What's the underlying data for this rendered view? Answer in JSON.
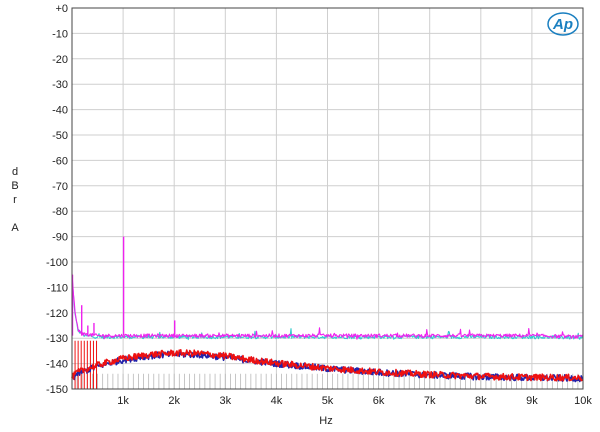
{
  "chart_data": {
    "type": "line",
    "title": "",
    "xlabel": "Hz",
    "ylabel_letters": [
      "d",
      "B",
      "r",
      "",
      "A"
    ],
    "xlim": [
      0,
      10000
    ],
    "ylim": [
      -150,
      0
    ],
    "grid": true,
    "x_ticks": [
      {
        "value": 1000,
        "label": "1k"
      },
      {
        "value": 2000,
        "label": "2k"
      },
      {
        "value": 3000,
        "label": "3k"
      },
      {
        "value": 4000,
        "label": "4k"
      },
      {
        "value": 5000,
        "label": "5k"
      },
      {
        "value": 6000,
        "label": "6k"
      },
      {
        "value": 7000,
        "label": "7k"
      },
      {
        "value": 8000,
        "label": "8k"
      },
      {
        "value": 9000,
        "label": "9k"
      },
      {
        "value": 10000,
        "label": "10k"
      }
    ],
    "y_ticks": [
      {
        "value": 0,
        "label": "+0"
      },
      {
        "value": -10,
        "label": "-10"
      },
      {
        "value": -20,
        "label": "-20"
      },
      {
        "value": -30,
        "label": "-30"
      },
      {
        "value": -40,
        "label": "-40"
      },
      {
        "value": -50,
        "label": "-50"
      },
      {
        "value": -60,
        "label": "-60"
      },
      {
        "value": -70,
        "label": "-70"
      },
      {
        "value": -80,
        "label": "-80"
      },
      {
        "value": -90,
        "label": "-90"
      },
      {
        "value": -100,
        "label": "-100"
      },
      {
        "value": -110,
        "label": "-110"
      },
      {
        "value": -120,
        "label": "-120"
      },
      {
        "value": -130,
        "label": "-130"
      },
      {
        "value": -140,
        "label": "-140"
      },
      {
        "value": -150,
        "label": "-150"
      }
    ],
    "series": [
      {
        "color": "#33cccc",
        "x": [
          0,
          60,
          120,
          250,
          500,
          1000,
          1500,
          2000,
          3000,
          4000,
          5000,
          6000,
          7000,
          8000,
          9000,
          10000
        ],
        "y": [
          -106,
          -121,
          -127,
          -129,
          -129.5,
          -129.5,
          -129.5,
          -129.5,
          -129.5,
          -129.5,
          -129.5,
          -129.5,
          -129.5,
          -129.5,
          -129.5,
          -129.8
        ]
      },
      {
        "color": "#ee22ee",
        "x": [
          0,
          60,
          120,
          250,
          500,
          1000,
          1500,
          2000,
          3000,
          4000,
          5000,
          6000,
          7000,
          8000,
          9000,
          10000
        ],
        "y": [
          -105,
          -120,
          -127,
          -128.5,
          -129,
          -129,
          -129,
          -129,
          -129,
          -129,
          -129,
          -129,
          -129,
          -129,
          -129,
          -129.5
        ]
      },
      {
        "color": "#2222aa",
        "x": [
          0,
          100,
          300,
          600,
          1000,
          1500,
          2000,
          2500,
          3000,
          3500,
          4000,
          5000,
          6000,
          7000,
          8000,
          9000,
          10000
        ],
        "y": [
          -146,
          -144,
          -142.5,
          -140.5,
          -138.5,
          -137,
          -136.3,
          -136.5,
          -137.5,
          -138.8,
          -140,
          -142,
          -143.5,
          -144.5,
          -145.2,
          -145.6,
          -145.8
        ]
      },
      {
        "color": "#ee1111",
        "x": [
          0,
          100,
          300,
          600,
          1000,
          1500,
          2000,
          2500,
          3000,
          3500,
          4000,
          5000,
          6000,
          7000,
          8000,
          9000,
          10000
        ],
        "y": [
          -145.5,
          -143.5,
          -142,
          -140,
          -138,
          -136.5,
          -135.8,
          -136,
          -137,
          -138.5,
          -139.8,
          -141.8,
          -143.3,
          -144.3,
          -145,
          -145.4,
          -145.6
        ]
      }
    ],
    "spikes": [
      {
        "x": 1000,
        "y": -90,
        "color": "#ee22ee"
      },
      {
        "x": 2000,
        "y": -123,
        "color": "#ee22ee"
      },
      {
        "x": 0,
        "y": -105,
        "color": "#ee22ee"
      },
      {
        "x": 180,
        "y": -117,
        "color": "#ee22ee"
      },
      {
        "x": 300,
        "y": -125,
        "color": "#ee22ee"
      },
      {
        "x": 420,
        "y": -124,
        "color": "#ee22ee"
      }
    ],
    "comb_red": {
      "start": 60,
      "end": 520,
      "step": 60,
      "top": -131
    },
    "comb_gray": {
      "start": 0,
      "end": 10000,
      "step": 100,
      "top": -144
    }
  },
  "logo": {
    "text": "Ap",
    "color": "#1a7fc0"
  }
}
